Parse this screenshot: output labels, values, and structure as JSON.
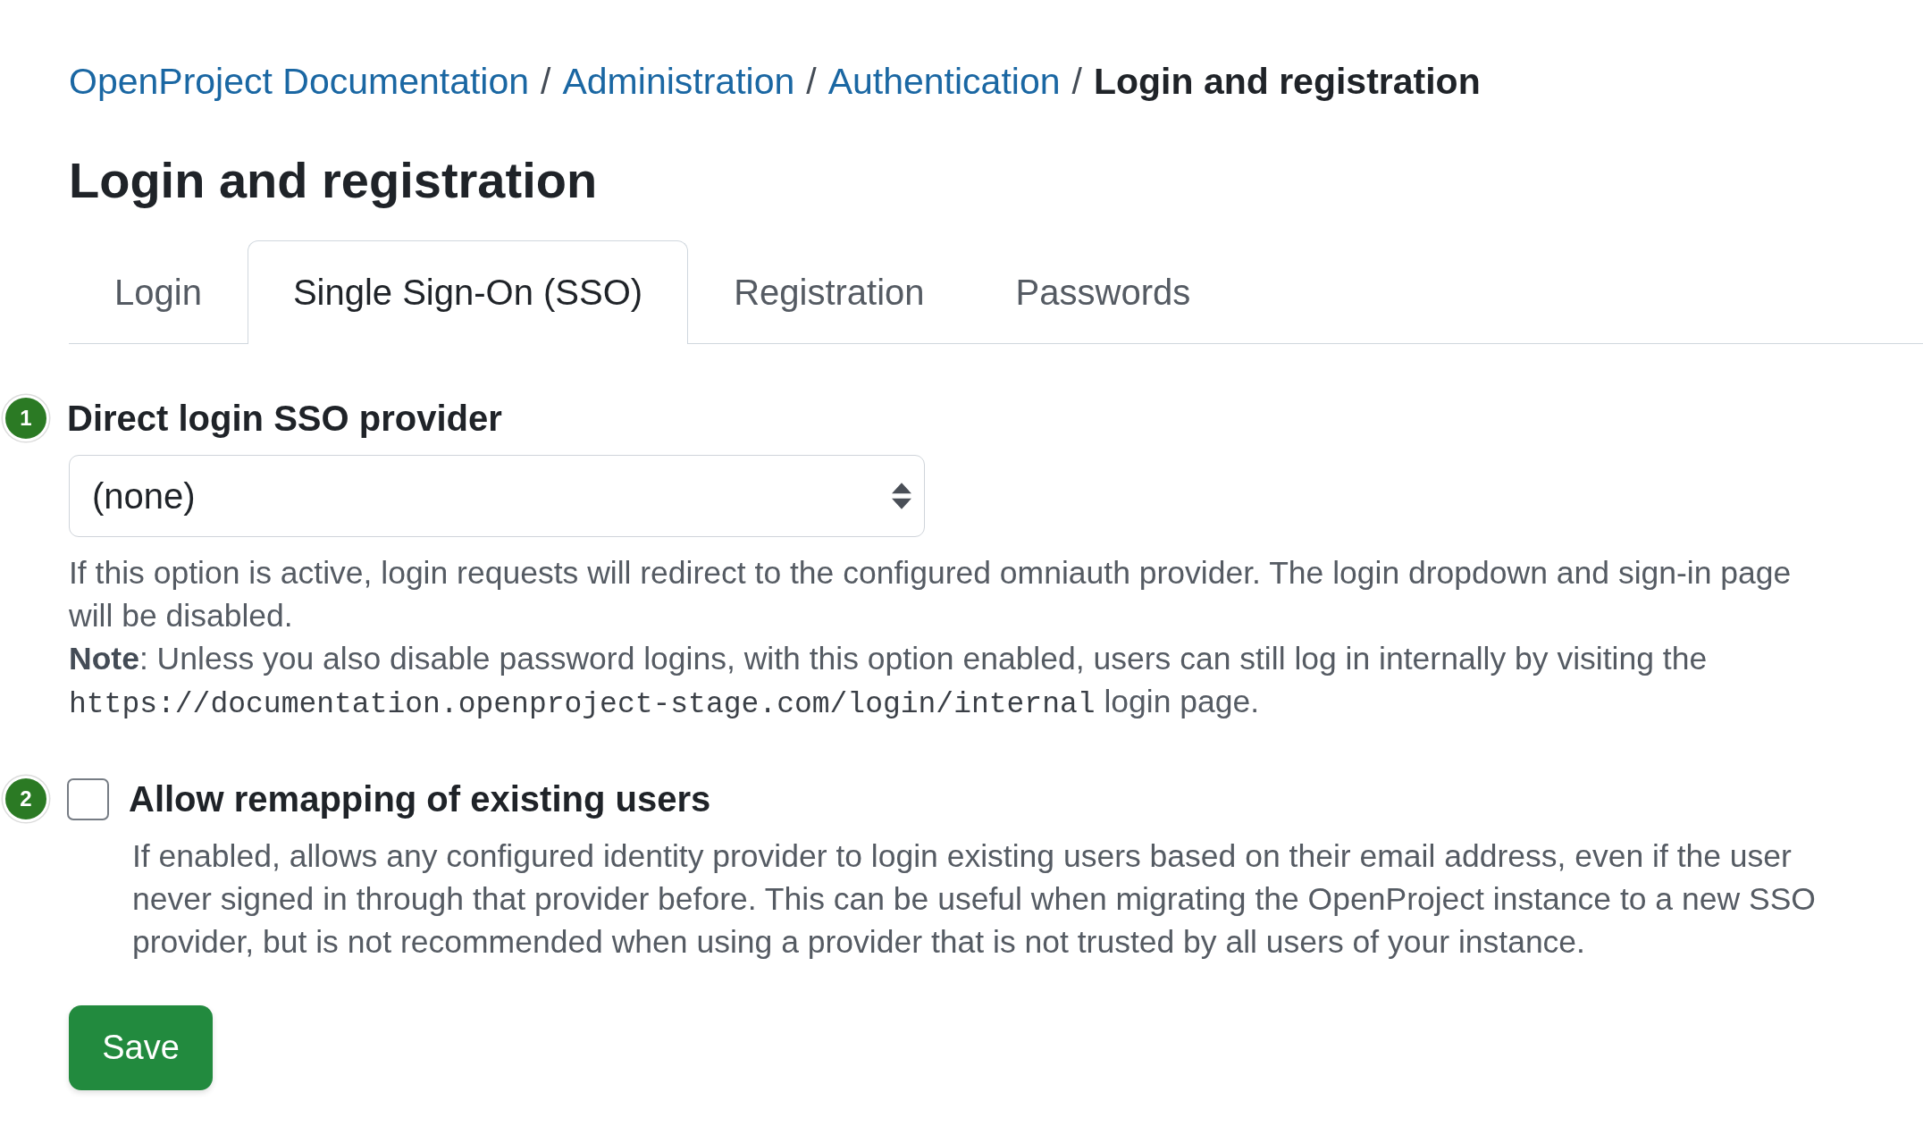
{
  "breadcrumb": [
    {
      "kind": "link",
      "label": "OpenProject Documentation",
      "separator": "/"
    },
    {
      "kind": "link",
      "label": "Administration",
      "separator": "/"
    },
    {
      "kind": "link",
      "label": "Authentication",
      "separator": "/"
    },
    {
      "kind": "current",
      "label": "Login and registration"
    }
  ],
  "page_title": "Login and registration",
  "tabs": [
    {
      "label": "Login",
      "selected": false
    },
    {
      "label": "Single Sign-On (SSO)",
      "selected": true
    },
    {
      "label": "Registration",
      "selected": false
    },
    {
      "label": "Passwords",
      "selected": false
    }
  ],
  "settings": [
    {
      "kind": "select",
      "number": "1",
      "label": "Direct login SSO provider",
      "value": "(none)",
      "help": [
        {
          "parts": [
            {
              "kind": "text",
              "text": "If this option is active, login requests will redirect to the configured omniauth provider. The login dropdown and sign-in page will be disabled."
            }
          ]
        },
        {
          "parts": [
            {
              "kind": "text",
              "text": "**Note**: Unless you also disable password logins, with this option enabled, users can still log in internally by visiting the "
            },
            {
              "kind": "code",
              "text": "https://documentation.openproject-stage.com/login/internal"
            },
            {
              "kind": "text",
              "text": " login page."
            }
          ]
        }
      ]
    },
    {
      "kind": "checkbox",
      "number": "2",
      "label": "Allow remapping of existing users",
      "checked": false,
      "help": [
        {
          "parts": [
            {
              "kind": "text",
              "text": "If enabled, allows any configured identity provider to login existing users based on their email address, even if the user never signed in through that provider before. This can be useful when migrating the OpenProject instance to a new SSO provider, but is not recommended when using a provider that is not trusted by all users of your instance."
            }
          ]
        }
      ]
    }
  ],
  "save_button": "Save"
}
